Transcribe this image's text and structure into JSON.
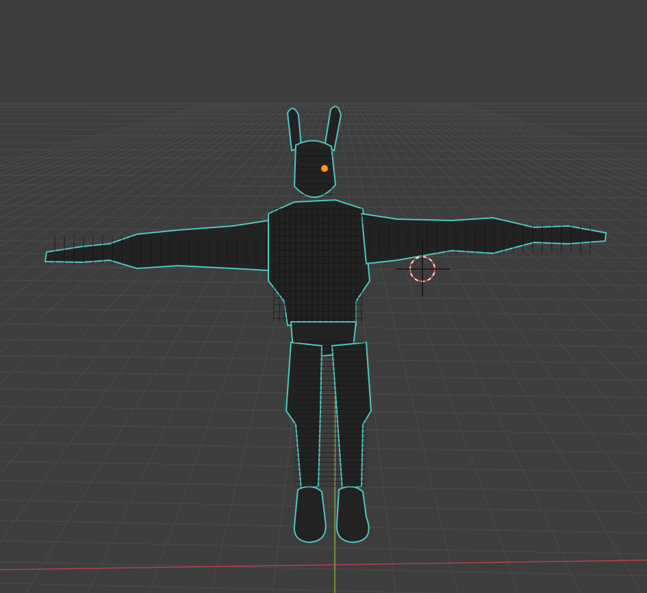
{
  "viewport": {
    "background": "#3d3d3d",
    "grid_color": "#4a4a4a",
    "x_axis_color": "#b8414f",
    "y_axis_color": "#7ea33d",
    "wire_color": "#1e1e1e",
    "outline_color": "#4ec7c2",
    "origin_color": "#ff9a1a",
    "cursor_color": "#d93434"
  },
  "scene": {
    "object": "character-mesh",
    "mode": "wireframe",
    "icons": [
      "3d-cursor-icon",
      "origin-point-icon"
    ]
  }
}
